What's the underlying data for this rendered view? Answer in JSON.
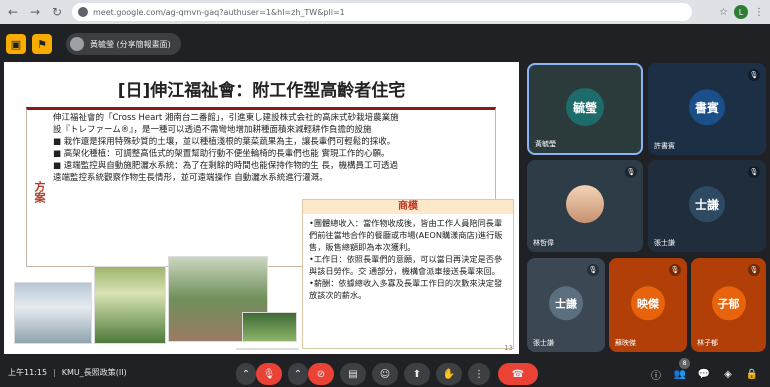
{
  "browser": {
    "url": "meet.google.com/ag-qmvn-gaq?authuser=1&hl=zh_TW&pli=1",
    "profile_initial": "L"
  },
  "presenter": {
    "chip_label": "黃毓瑩 (分享簡報畫面)"
  },
  "slide": {
    "title": "[日]伸江福祉會：附工作型高齡者住宅",
    "method_label": "方案",
    "method_lines": [
      "伸江福祉會的「Cross Heart 湘南台二番館」，引進東し建設株式会社的高床式砂栽培農業施",
      "設『トレファーム®』，是一種可以透過不需彎地增加耕種面積來減輕耕作負擔的設施",
      "■ 栽作還是採用特殊砂質的土壤，並以種植淺根的葉菜蔬果為主，讓長輩們可輕鬆的採收。",
      "■ 高架化種植：可調整高低式的架置幫助行動不便坐輪椅的長輩們也能 實現工作的心願。",
      "■ 遠端監控與自動施肥灑水系統：為了在剩餘的時間也能保持作物的生 長，機構員工可透過",
      "遠端監控系統觀察作物生長情形，並可遠端操作 自動灑水系統進行灌溉。"
    ],
    "profit_label": "商模",
    "profit_lines": [
      "•團體總收入：當作物收成後，皆由工作人員陪同長輩們前往當地合作的餐廳或市場(AEON購漾商店)進行販售，販售總額即為本次獲利。",
      "•工作日：依照長輩們的意願，可以當日再決定是否參與該日勞作。交 通部分，機構會派車接送長輩來回。",
      "•薪酬：依據總收入多寡及長輩工作日的次數來決定發放該次的薪水。"
    ],
    "page_number": "13"
  },
  "participants": [
    {
      "name": "黃毓瑩",
      "avatar_text": "毓瑩",
      "color": "#1e6b6b",
      "muted": false,
      "highlight": true
    },
    {
      "name": "許書賓",
      "avatar_text": "書賓",
      "color": "#1a4f8a",
      "muted": true
    },
    {
      "name": "林哲偉",
      "avatar_text": "",
      "color": "#2e4a63",
      "muted": true,
      "photo": true
    },
    {
      "name": "張士謙",
      "avatar_text": "士謙",
      "color": "#2e4a63",
      "muted": true
    },
    {
      "name": "張士謙",
      "avatar_text": "士謙",
      "color": "#5b6f7f",
      "muted": true
    },
    {
      "name": "蘇映傑",
      "avatar_text": "映傑",
      "color": "#e8640c",
      "muted": true
    },
    {
      "name": "林子郁",
      "avatar_text": "子郁",
      "color": "#e8640c",
      "muted": true
    }
  ],
  "bottom": {
    "time": "上午11:15",
    "meeting": "KMU_長照政策(II)",
    "participant_count": "8"
  },
  "colors": {
    "end_call": "#ea4335",
    "accent": "#f9ab00"
  }
}
